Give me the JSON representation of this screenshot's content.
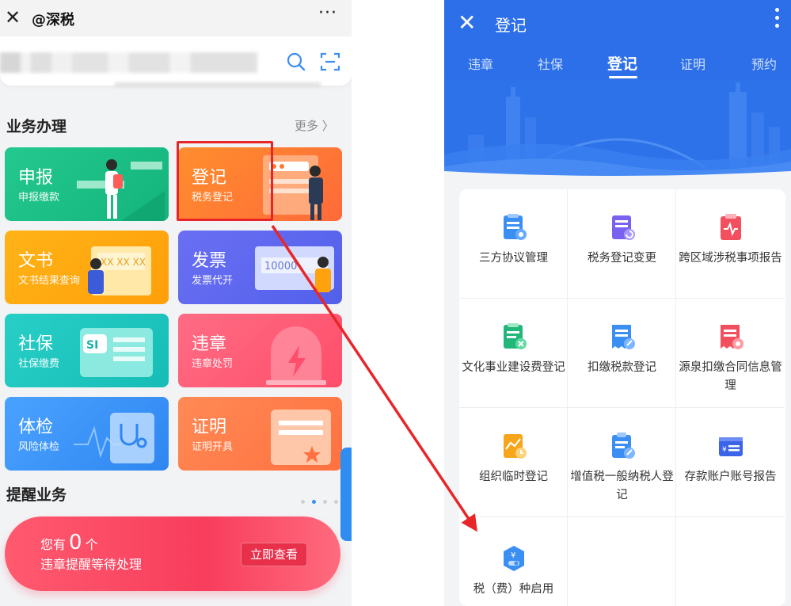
{
  "left": {
    "app_title": "@深税",
    "more_label": "···",
    "section_business": "业务办理",
    "more_link": "更多 〉",
    "tiles": [
      {
        "title": "申报",
        "sub": "申报缴款",
        "color": "#1fc08a"
      },
      {
        "title": "登记",
        "sub": "税务登记",
        "color": "#ff7a2e"
      },
      {
        "title": "文书",
        "sub": "文书结果查询",
        "color": "#ffa90f"
      },
      {
        "title": "发票",
        "sub": "发票代开",
        "color": "#5b6ff1"
      },
      {
        "title": "社保",
        "sub": "社保缴费",
        "color": "#22c5c0"
      },
      {
        "title": "违章",
        "sub": "违章处罚",
        "color": "#ff5a74"
      },
      {
        "title": "体检",
        "sub": "风险体检",
        "color": "#3d8ff5"
      },
      {
        "title": "证明",
        "sub": "证明开具",
        "color": "#ff7c48"
      }
    ],
    "art_texts": {
      "wenshu": "XX XX XX",
      "fapiao": "10000",
      "shebao": "SI"
    },
    "section_remind": "提醒业务",
    "remind": {
      "prefix": "您有",
      "count": "0",
      "suffix": "个",
      "line2": "违章提醒等待处理",
      "button": "立即查看"
    }
  },
  "right": {
    "title": "登记",
    "tabs": [
      "违章",
      "社保",
      "登记",
      "证明",
      "预约"
    ],
    "active_tab": "登记",
    "items": [
      {
        "label": "三方协议管理",
        "icon": "agreement-doc-icon",
        "color": "#3b8ff3"
      },
      {
        "label": "税务登记变更",
        "icon": "register-change-icon",
        "color": "#7a61f0"
      },
      {
        "label": "跨区域涉税事项报告",
        "icon": "cross-region-report-icon",
        "color": "#f3505f"
      },
      {
        "label": "文化事业建设费登记",
        "icon": "culture-fee-icon",
        "color": "#21b77a"
      },
      {
        "label": "扣缴税款登记",
        "icon": "withholding-icon",
        "color": "#3b8ff3"
      },
      {
        "label": "源泉扣缴合同信息管理",
        "icon": "source-withholding-icon",
        "color": "#f3505f"
      },
      {
        "label": "组织临时登记",
        "icon": "temp-register-icon",
        "color": "#f7a51b"
      },
      {
        "label": "增值税一般纳税人登记",
        "icon": "vat-taxpayer-icon",
        "color": "#3b8ff3"
      },
      {
        "label": "存款账户账号报告",
        "icon": "bank-account-icon",
        "color": "#3b64e8"
      },
      {
        "label": "税（费）种启用",
        "icon": "tax-type-enable-icon",
        "color": "#3b8ff3"
      }
    ]
  }
}
